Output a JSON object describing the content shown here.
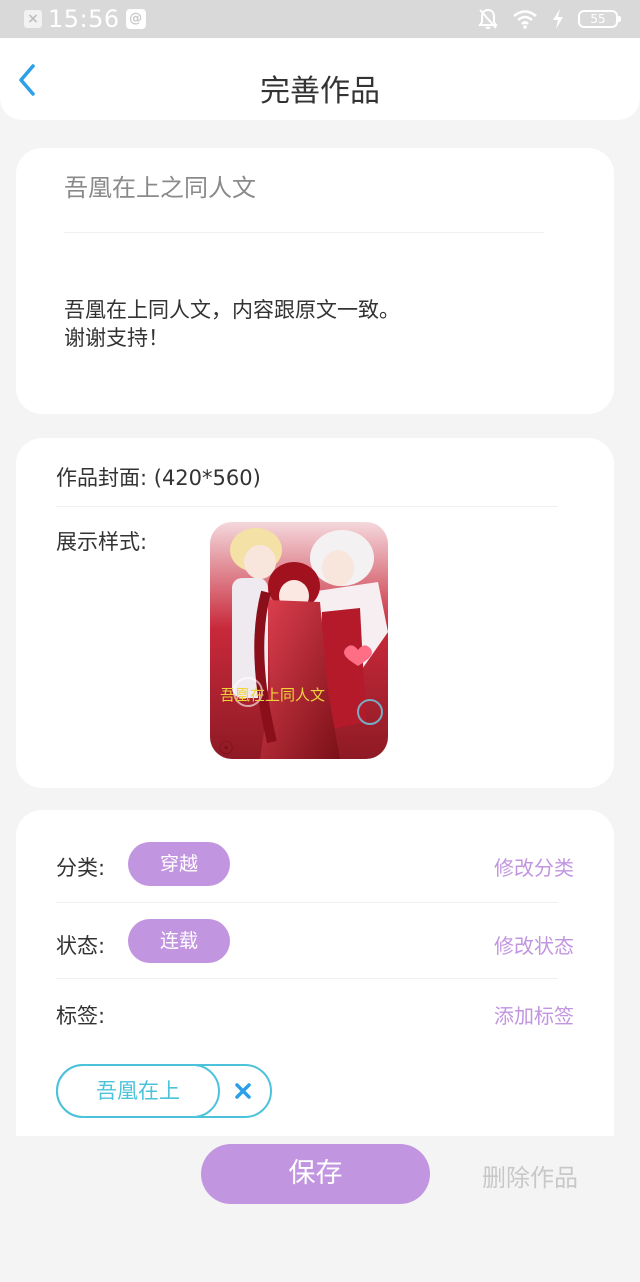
{
  "status_bar": {
    "time": "15:56",
    "battery": "55",
    "notification_icons": [
      "close-box-icon",
      "at-icon"
    ],
    "system_icons": [
      "bell-off-icon",
      "wifi-icon",
      "charging-icon",
      "battery-icon"
    ]
  },
  "header": {
    "title": "完善作品",
    "back_icon": "chevron-left-icon"
  },
  "work": {
    "title": "吾凰在上之同人文",
    "description_lines": [
      "吾凰在上同人文，内容跟原文一致。",
      "谢谢支持！"
    ]
  },
  "cover": {
    "label": "作品封面:  (420*560)",
    "display_label": "展示样式:",
    "image_caption": "吾凰在上同人文"
  },
  "details": {
    "category_label": "分类:",
    "category_value": "穿越",
    "category_action": "修改分类",
    "status_label": "状态:",
    "status_value": "连载",
    "status_action": "修改状态",
    "tags_label": "标签:",
    "tags_action": "添加标签",
    "tags": [
      "吾凰在上"
    ]
  },
  "actions": {
    "save": "保存",
    "delete": "删除作品"
  },
  "colors": {
    "accent_purple": "#c295e1",
    "tag_cyan": "#4dc3db",
    "back_blue": "#2c9fea"
  }
}
